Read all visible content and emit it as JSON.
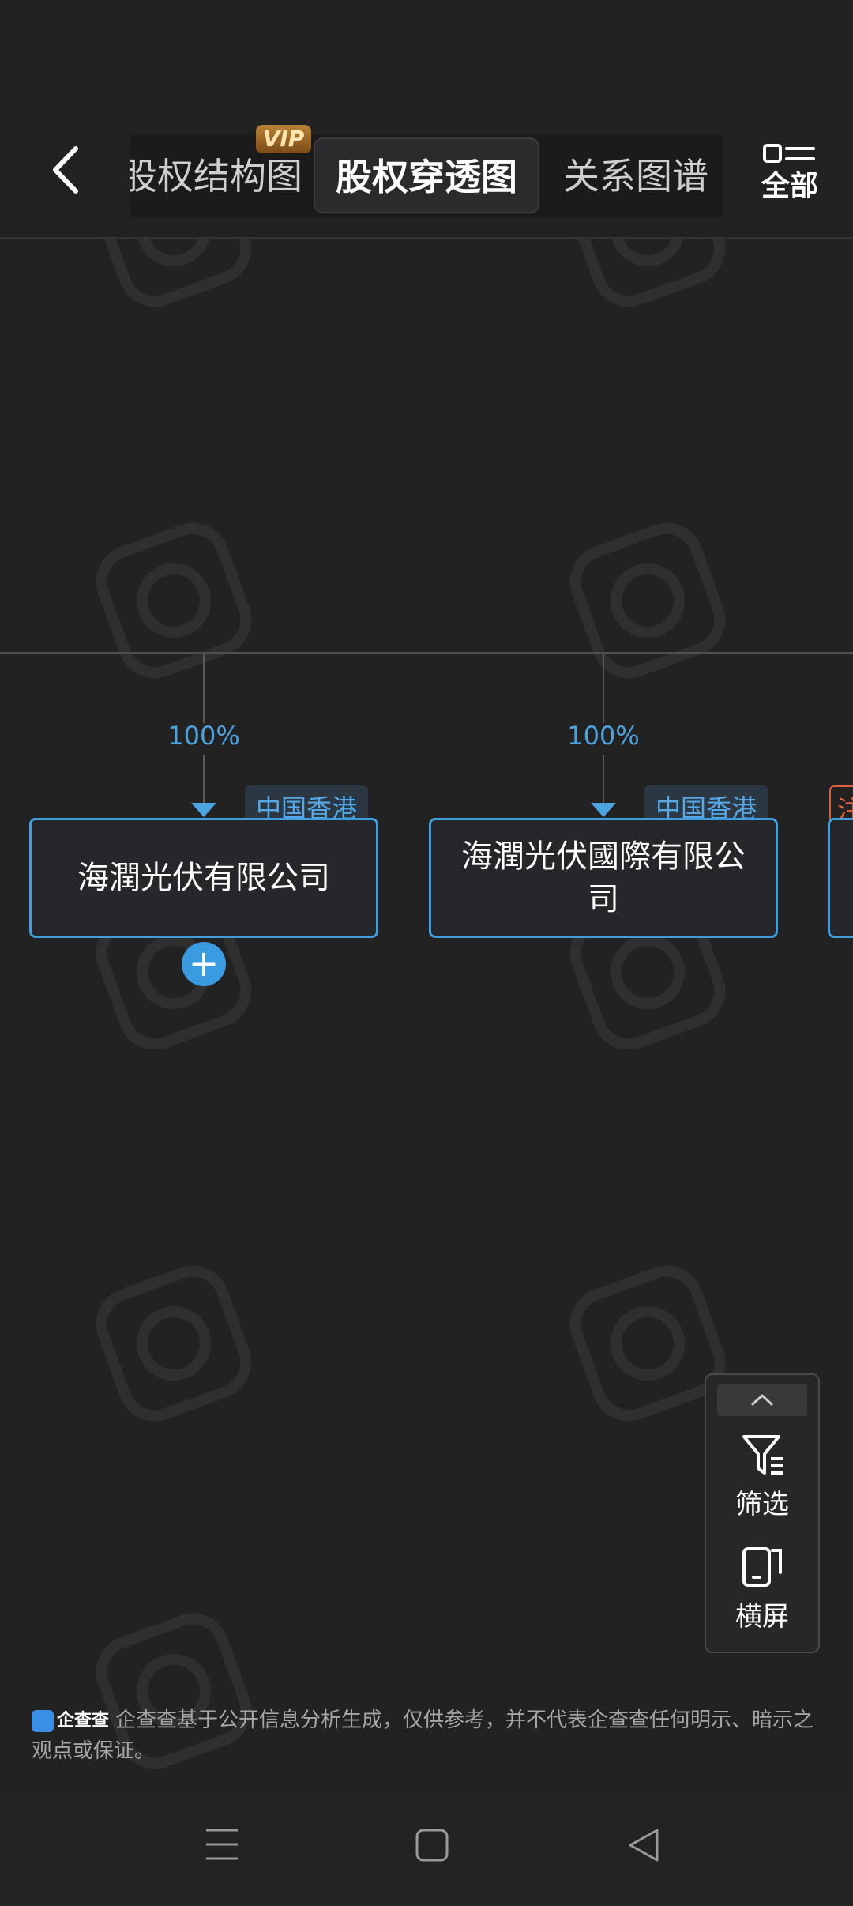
{
  "header": {
    "tabs": [
      {
        "label": "股权结构图",
        "badge": "VIP"
      },
      {
        "label": "股权穿透图",
        "active": true
      },
      {
        "label": "关系图谱"
      }
    ],
    "all_label": "全部"
  },
  "tree": {
    "nodes": [
      {
        "percent": "100%",
        "region": "中国香港",
        "name": "海潤光伏有限公司",
        "expandable": true
      },
      {
        "percent": "100%",
        "region": "中国香港",
        "name": "海潤光伏國際有限公司"
      },
      {
        "region": "注"
      }
    ],
    "expand_symbol": "+"
  },
  "float_panel": {
    "filter_label": "筛选",
    "landscape_label": "横屏"
  },
  "disclaimer": {
    "brand": "企查查",
    "text": "企查查基于公开信息分析生成，仅供参考，并不代表企查查任何明示、暗示之观点或保证。"
  },
  "colors": {
    "background": "#222223",
    "accent": "#3f9ede",
    "tag_bg": "#2c3744",
    "vip_badge": "#a56a25",
    "third_tag": "#e0603a"
  },
  "icons": [
    "back-arrow-icon",
    "all-menu-icon",
    "chevron-up-icon",
    "filter-icon",
    "landscape-icon",
    "menu-nav-icon",
    "home-nav-icon",
    "back-nav-icon"
  ]
}
